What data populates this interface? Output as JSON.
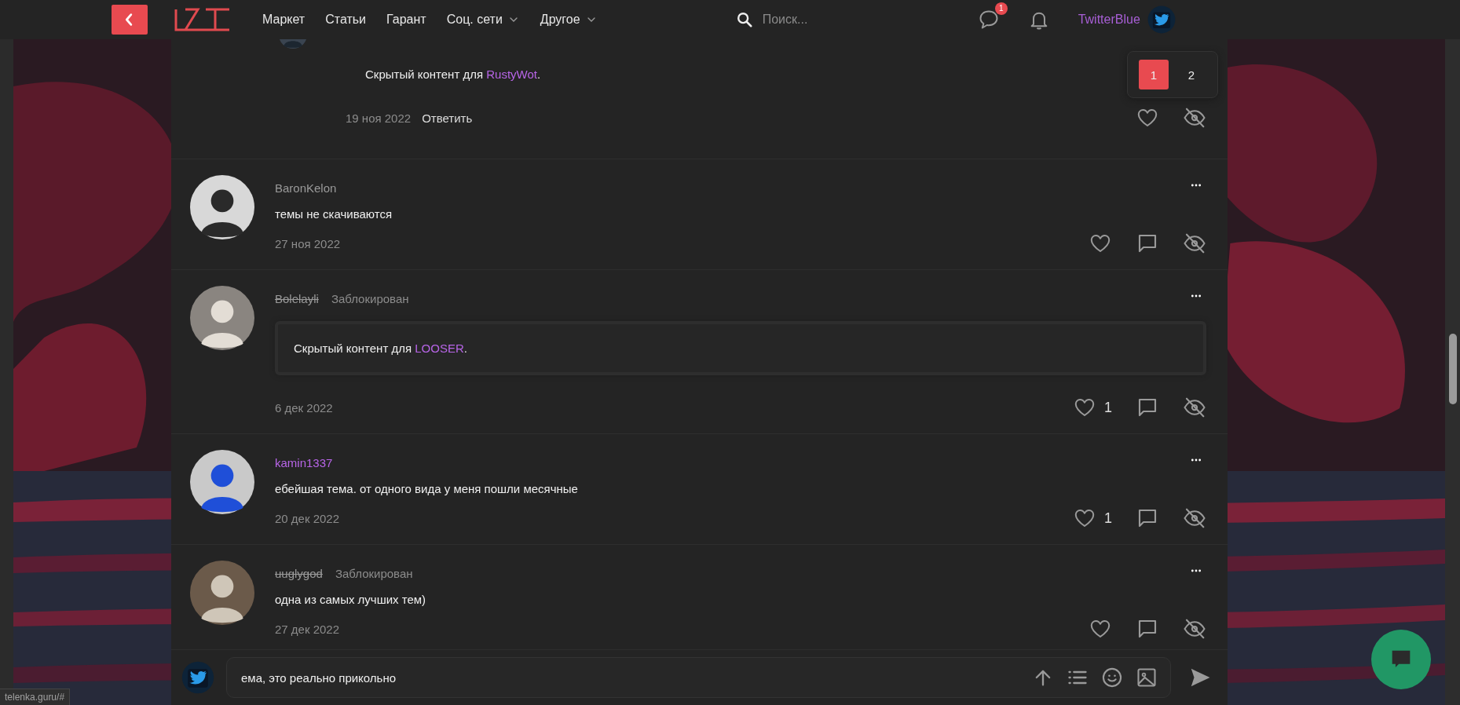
{
  "header": {
    "nav": [
      {
        "label": "Маркет",
        "dropdown": false
      },
      {
        "label": "Статьи",
        "dropdown": false
      },
      {
        "label": "Гарант",
        "dropdown": false
      },
      {
        "label": "Соц. сети",
        "dropdown": true
      },
      {
        "label": "Другое",
        "dropdown": true
      }
    ],
    "search": {
      "placeholder": "Поиск..."
    },
    "messages_badge": "1",
    "username": "TwitterBlue"
  },
  "pagination": [
    {
      "label": "1",
      "selected": true
    },
    {
      "label": "2",
      "selected": false
    }
  ],
  "comments": [
    {
      "kind": "reply",
      "hidden": {
        "prefix": "Скрытый контент для ",
        "user": "RustyWot",
        "suffix": "."
      },
      "date": "19 ноя 2022",
      "reply_label": "Ответить",
      "actions": [
        {
          "kind": "like"
        },
        {
          "kind": "hide"
        }
      ]
    },
    {
      "kind": "post",
      "author": "BaronKelon",
      "color": "#9a9a9a",
      "banned": false,
      "text": "темы не скачиваются",
      "date": "27 ноя 2022",
      "actions": [
        {
          "kind": "like"
        },
        {
          "kind": "comment"
        },
        {
          "kind": "hide"
        }
      ]
    },
    {
      "kind": "post",
      "author": "Bolelayli",
      "color": "#9a9a9a",
      "banned": true,
      "status": "Заблокирован",
      "hidden": {
        "prefix": "Скрытый контент для ",
        "user": "LOOSER",
        "suffix": "."
      },
      "date": "6 дек 2022",
      "actions": [
        {
          "kind": "like",
          "count": "1"
        },
        {
          "kind": "comment"
        },
        {
          "kind": "hide"
        }
      ]
    },
    {
      "kind": "post",
      "author": "kamin1337",
      "color": "#b865e8",
      "banned": false,
      "text": "ебейшая тема. от одного вида у меня пошли месячные",
      "date": "20 дек 2022",
      "actions": [
        {
          "kind": "like",
          "count": "1"
        },
        {
          "kind": "comment"
        },
        {
          "kind": "hide"
        }
      ]
    },
    {
      "kind": "post",
      "author": "uuglygod",
      "color": "#9a9a9a",
      "banned": true,
      "status": "Заблокирован",
      "text": "одна из самых лучших тем)",
      "date": "27 дек 2022",
      "actions": [
        {
          "kind": "like"
        },
        {
          "kind": "comment"
        },
        {
          "kind": "hide"
        }
      ]
    }
  ],
  "composer": {
    "value": "ема, это реально прикольно"
  },
  "status_url": "telenka.guru/#"
}
